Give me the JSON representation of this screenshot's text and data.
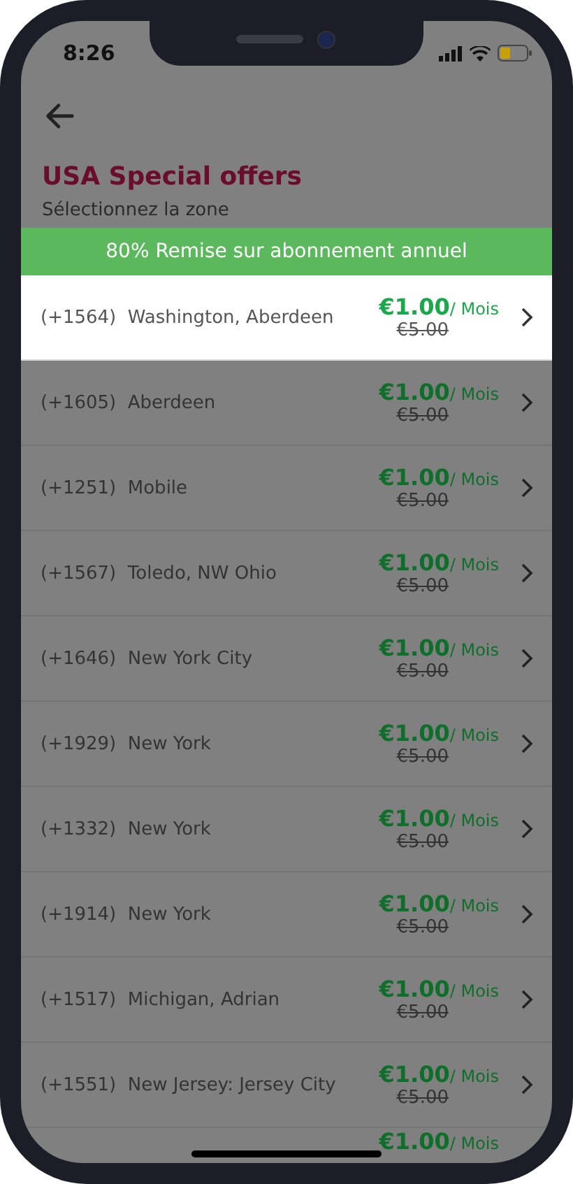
{
  "status_bar": {
    "time": "8:26"
  },
  "header": {
    "title": "USA Special offers",
    "subtitle": "Sélectionnez la zone"
  },
  "banner": "80% Remise sur abonnement annuel",
  "zones": [
    {
      "code": "(+1564)",
      "name": "Washington, Aberdeen",
      "price": "€1.00",
      "per": "/ Mois",
      "old_price": "€5.00",
      "selected": true
    },
    {
      "code": "(+1605)",
      "name": "Aberdeen",
      "price": "€1.00",
      "per": "/ Mois",
      "old_price": "€5.00",
      "selected": false
    },
    {
      "code": "(+1251)",
      "name": "Mobile",
      "price": "€1.00",
      "per": "/ Mois",
      "old_price": "€5.00",
      "selected": false
    },
    {
      "code": "(+1567)",
      "name": "Toledo, NW Ohio",
      "price": "€1.00",
      "per": "/ Mois",
      "old_price": "€5.00",
      "selected": false
    },
    {
      "code": "(+1646)",
      "name": "New York City",
      "price": "€1.00",
      "per": "/ Mois",
      "old_price": "€5.00",
      "selected": false
    },
    {
      "code": "(+1929)",
      "name": "New York",
      "price": "€1.00",
      "per": "/ Mois",
      "old_price": "€5.00",
      "selected": false
    },
    {
      "code": "(+1332)",
      "name": "New York",
      "price": "€1.00",
      "per": "/ Mois",
      "old_price": "€5.00",
      "selected": false
    },
    {
      "code": "(+1914)",
      "name": "New York",
      "price": "€1.00",
      "per": "/ Mois",
      "old_price": "€5.00",
      "selected": false
    },
    {
      "code": "(+1517)",
      "name": "Michigan, Adrian",
      "price": "€1.00",
      "per": "/ Mois",
      "old_price": "€5.00",
      "selected": false
    },
    {
      "code": "(+1551)",
      "name": "New Jersey: Jersey City",
      "price": "€1.00",
      "per": "/ Mois",
      "old_price": "€5.00",
      "selected": false
    },
    {
      "price": "€1.00",
      "per": "/ Mois",
      "selected": false
    }
  ]
}
